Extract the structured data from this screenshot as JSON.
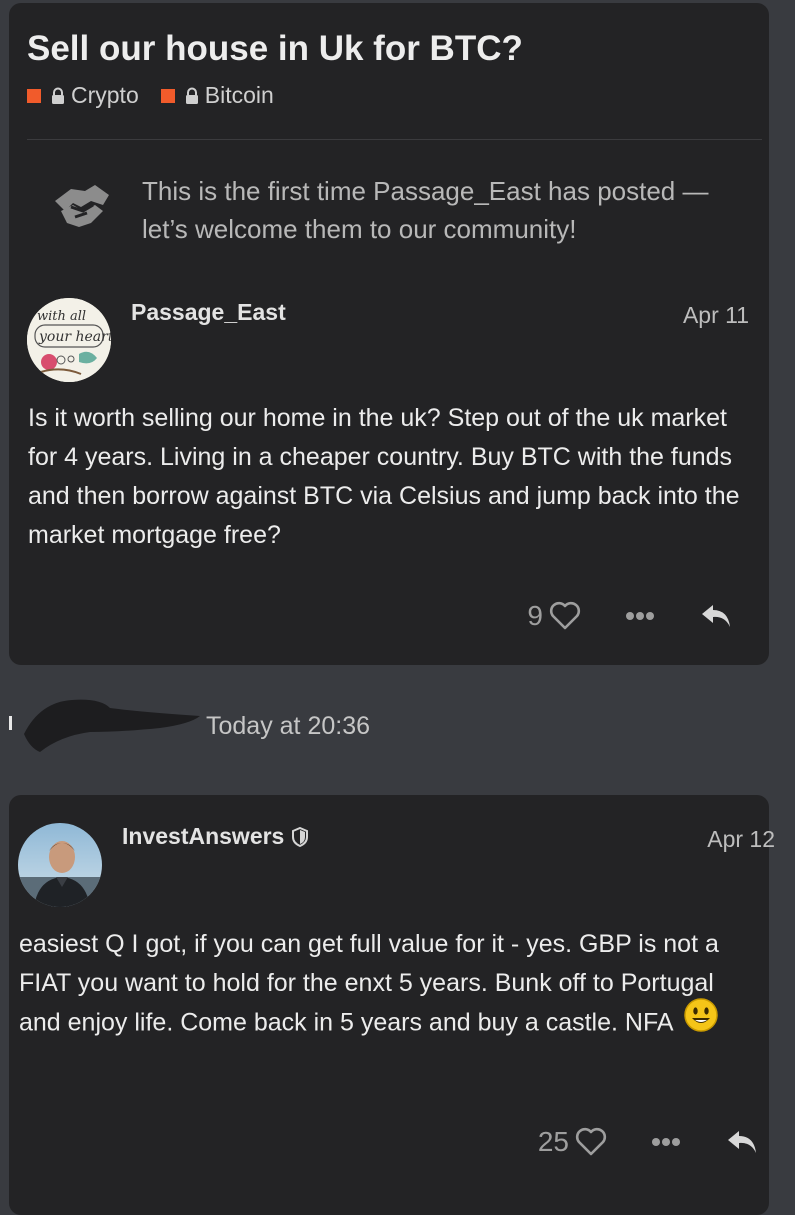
{
  "topic": {
    "title": "Sell our house in Uk for BTC?",
    "categories": [
      {
        "name": "Crypto",
        "color": "#f15b2b",
        "icon": "lock-icon"
      },
      {
        "name": "Bitcoin",
        "color": "#f15b2b",
        "icon": "lock-icon"
      }
    ],
    "welcome_message": "This is the first time Passage_East has posted — let’s welcome them to our community!"
  },
  "posts": [
    {
      "username": "Passage_East",
      "date": "Apr 11",
      "body": "Is it worth selling our home in the uk? Step out of the uk market for 4 years. Living in a cheaper country. Buy BTC with the funds and then borrow against BTC via Celsius and jump back into the market mortgage free?",
      "likes": "9",
      "avatar_text": "with all your heart"
    },
    {
      "username": "InvestAnswers",
      "date": "Apr 12",
      "body": "easiest Q I got, if you can get full value for it - yes. GBP is not a FIAT you want to hold for the enxt 5 years. Bunk off to Portugal and enjoy life. Come back in 5 years and buy a castle. NFA",
      "likes": "25",
      "has_moderator_badge": true,
      "emoji": "smiley-emoji"
    }
  ],
  "gap_entry": {
    "time": "Today at 20:36"
  },
  "colors": {
    "page_background": "#393b40",
    "card_background": "#232325",
    "category_accent": "#f15b2b"
  }
}
